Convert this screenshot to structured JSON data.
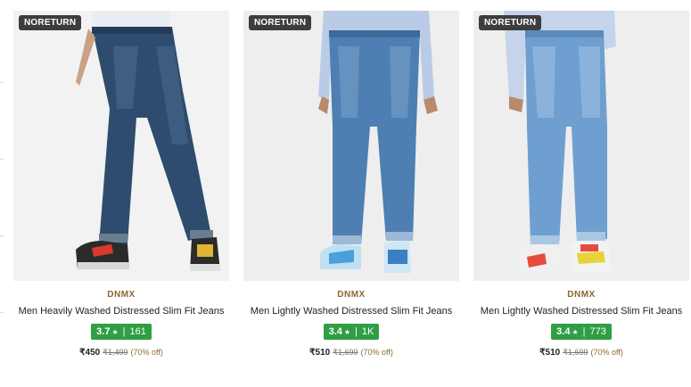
{
  "products": [
    {
      "badge": "NORETURN",
      "brand": "DNMX",
      "name": "Men Heavily Washed Distressed Slim Fit Jeans",
      "rating": "3.7",
      "star": "★",
      "reviews": "161",
      "price": "₹450",
      "mrp": "₹1,499",
      "discount": "(70% off)",
      "colors": {
        "bg": "#f2f2f2",
        "denim": "#2e4d6e",
        "denim_light": "#4f7196",
        "shirt": "#e9eef3"
      }
    },
    {
      "badge": "NORETURN",
      "brand": "DNMX",
      "name": "Men Lightly Washed Distressed Slim Fit Jeans",
      "rating": "3.4",
      "star": "★",
      "reviews": "1K",
      "price": "₹510",
      "mrp": "₹1,699",
      "discount": "(70% off)",
      "colors": {
        "bg": "#eeeeee",
        "denim": "#4d7fb3",
        "denim_light": "#7aa2c9",
        "shirt": "#b9cbe6"
      }
    },
    {
      "badge": "NORETURN",
      "brand": "DNMX",
      "name": "Men Lightly Washed Distressed Slim Fit Jeans",
      "rating": "3.4",
      "star": "★",
      "reviews": "773",
      "price": "₹510",
      "mrp": "₹1,699",
      "discount": "(70% off)",
      "colors": {
        "bg": "#eeeeee",
        "denim": "#6f9fd0",
        "denim_light": "#9cc0e2",
        "shirt": "#c5d4ea"
      }
    }
  ]
}
